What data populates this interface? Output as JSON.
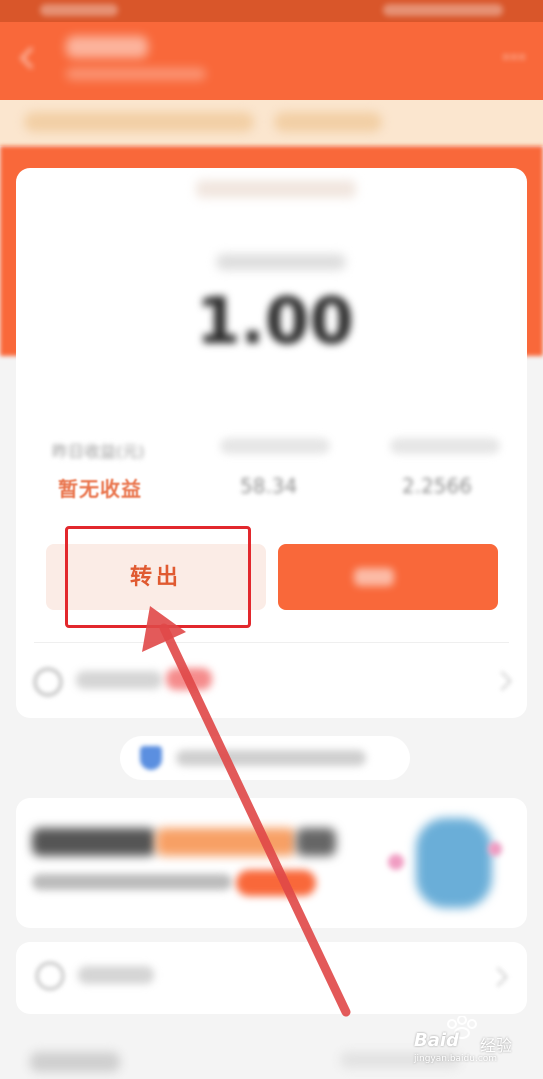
{
  "colors": {
    "brand_orange": "#f9683a",
    "accent_red": "#e2282d",
    "earnings_text": "#e9744c"
  },
  "header": {
    "back_icon": "back-arrow-icon",
    "more_icon": "more-icon"
  },
  "account": {
    "amount": "1.00"
  },
  "stats": {
    "yesterday_label": "昨日收益(元)",
    "yesterday_value": "暂无收益",
    "value_2": "58.34",
    "value_3": "2.2566"
  },
  "actions": {
    "transfer_out_label": "转出"
  },
  "watermark": {
    "logo": "Baid",
    "text": "经验",
    "url": "jingyan.baidu.com"
  }
}
